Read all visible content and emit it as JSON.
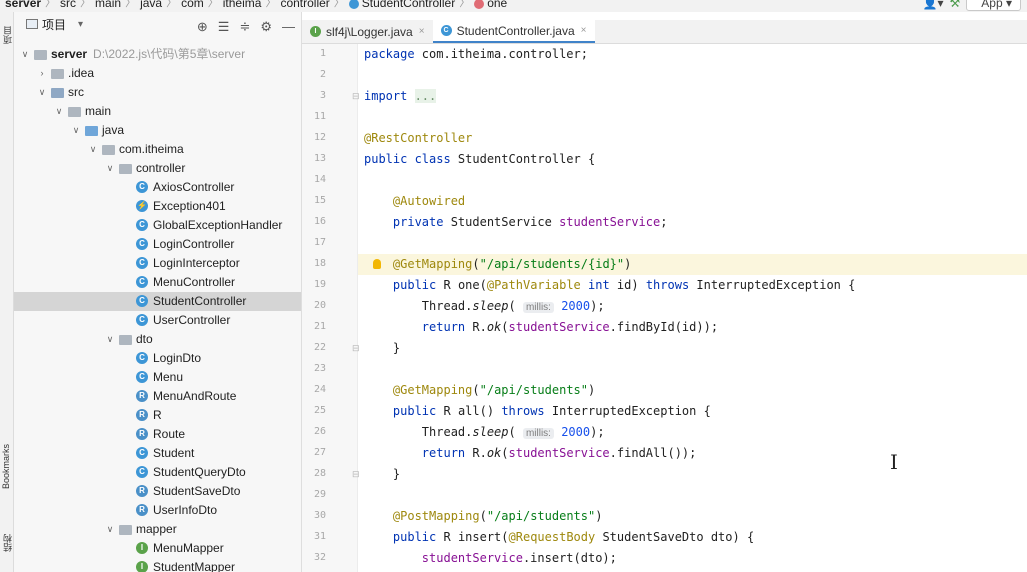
{
  "breadcrumb": {
    "items": [
      "server",
      "src",
      "main",
      "java",
      "com",
      "itheima",
      "controller",
      "StudentController",
      "one"
    ],
    "separator": "〉"
  },
  "topbar": {
    "app_config": "App ▾"
  },
  "toolstrip": {
    "project_label": "项目",
    "bookmarks_label": "Bookmarks",
    "structure_label": "结构"
  },
  "project_panel": {
    "title": "项目",
    "title_arrow": "▾",
    "tree": [
      {
        "label": "server",
        "hint": "D:\\2022.js\\代码\\第5章\\server",
        "icon": "module",
        "depth": 0,
        "expanded": true
      },
      {
        "label": ".idea",
        "icon": "folder",
        "depth": 1,
        "expanded": false
      },
      {
        "label": "src",
        "icon": "folder-src",
        "depth": 1,
        "expanded": true
      },
      {
        "label": "main",
        "icon": "folder",
        "depth": 2,
        "expanded": true
      },
      {
        "label": "java",
        "icon": "folder-java",
        "depth": 3,
        "expanded": true
      },
      {
        "label": "com.itheima",
        "icon": "package",
        "depth": 4,
        "expanded": true
      },
      {
        "label": "controller",
        "icon": "package",
        "depth": 5,
        "expanded": true
      },
      {
        "label": "AxiosController",
        "icon": "class",
        "depth": 6
      },
      {
        "label": "Exception401",
        "icon": "exception",
        "depth": 6
      },
      {
        "label": "GlobalExceptionHandler",
        "icon": "class",
        "depth": 6
      },
      {
        "label": "LoginController",
        "icon": "class",
        "depth": 6
      },
      {
        "label": "LoginInterceptor",
        "icon": "class",
        "depth": 6
      },
      {
        "label": "MenuController",
        "icon": "class",
        "depth": 6
      },
      {
        "label": "StudentController",
        "icon": "class",
        "depth": 6,
        "selected": true
      },
      {
        "label": "UserController",
        "icon": "class",
        "depth": 6
      },
      {
        "label": "dto",
        "icon": "package",
        "depth": 5,
        "expanded": true
      },
      {
        "label": "LoginDto",
        "icon": "class",
        "depth": 6
      },
      {
        "label": "Menu",
        "icon": "class",
        "depth": 6
      },
      {
        "label": "MenuAndRoute",
        "icon": "record",
        "depth": 6
      },
      {
        "label": "R",
        "icon": "record",
        "depth": 6
      },
      {
        "label": "Route",
        "icon": "record",
        "depth": 6
      },
      {
        "label": "Student",
        "icon": "class",
        "depth": 6
      },
      {
        "label": "StudentQueryDto",
        "icon": "class",
        "depth": 6
      },
      {
        "label": "StudentSaveDto",
        "icon": "record",
        "depth": 6
      },
      {
        "label": "UserInfoDto",
        "icon": "record",
        "depth": 6
      },
      {
        "label": "mapper",
        "icon": "package",
        "depth": 5,
        "expanded": true
      },
      {
        "label": "MenuMapper",
        "icon": "interface",
        "depth": 6
      },
      {
        "label": "StudentMapper",
        "icon": "interface",
        "depth": 6
      }
    ]
  },
  "tabs": [
    {
      "label": "slf4j\\Logger.java",
      "icon": "interface",
      "active": false
    },
    {
      "label": "StudentController.java",
      "icon": "class",
      "active": true
    }
  ],
  "editor": {
    "lines": [
      {
        "n": "1",
        "tokens": [
          {
            "t": "package ",
            "c": "kw"
          },
          {
            "t": "com.itheima.controller;",
            "c": ""
          }
        ]
      },
      {
        "n": "2",
        "tokens": []
      },
      {
        "n": "3",
        "tokens": [
          {
            "t": "import ",
            "c": "kw"
          },
          {
            "t": "...",
            "c": "fold"
          }
        ],
        "fold": true
      },
      {
        "n": "11",
        "tokens": []
      },
      {
        "n": "12",
        "tokens": [
          {
            "t": "@RestController",
            "c": "ann"
          }
        ]
      },
      {
        "n": "13",
        "tokens": [
          {
            "t": "public class ",
            "c": "kw"
          },
          {
            "t": "StudentController {",
            "c": ""
          }
        ]
      },
      {
        "n": "14",
        "tokens": []
      },
      {
        "n": "15",
        "tokens": [
          {
            "t": "    ",
            "c": ""
          },
          {
            "t": "@Autowired",
            "c": "ann"
          }
        ]
      },
      {
        "n": "16",
        "tokens": [
          {
            "t": "    ",
            "c": ""
          },
          {
            "t": "private ",
            "c": "kw"
          },
          {
            "t": "StudentService ",
            "c": ""
          },
          {
            "t": "studentService",
            "c": "fld"
          },
          {
            "t": ";",
            "c": ""
          }
        ]
      },
      {
        "n": "17",
        "tokens": []
      },
      {
        "n": "18",
        "tokens": [
          {
            "t": "    ",
            "c": ""
          },
          {
            "t": "@GetMapping",
            "c": "ann"
          },
          {
            "t": "(",
            "c": ""
          },
          {
            "t": "\"/api/students/{id}\"",
            "c": "str"
          },
          {
            "t": ")",
            "c": ""
          }
        ],
        "highlight": true,
        "bulb": true
      },
      {
        "n": "19",
        "tokens": [
          {
            "t": "    ",
            "c": ""
          },
          {
            "t": "public ",
            "c": "kw"
          },
          {
            "t": "R ",
            "c": ""
          },
          {
            "t": "one",
            "c": ""
          },
          {
            "t": "(",
            "c": ""
          },
          {
            "t": "@PathVariable ",
            "c": "ann"
          },
          {
            "t": "int ",
            "c": "kw"
          },
          {
            "t": "id) ",
            "c": ""
          },
          {
            "t": "throws ",
            "c": "kw"
          },
          {
            "t": "InterruptedException {",
            "c": ""
          }
        ]
      },
      {
        "n": "20",
        "tokens": [
          {
            "t": "        Thread.",
            "c": ""
          },
          {
            "t": "sleep",
            "c": "ital"
          },
          {
            "t": "( ",
            "c": ""
          },
          {
            "t": "millis:",
            "c": "hint"
          },
          {
            "t": " ",
            "c": ""
          },
          {
            "t": "2000",
            "c": "num"
          },
          {
            "t": ");",
            "c": ""
          }
        ]
      },
      {
        "n": "21",
        "tokens": [
          {
            "t": "        ",
            "c": ""
          },
          {
            "t": "return ",
            "c": "kw"
          },
          {
            "t": "R.",
            "c": ""
          },
          {
            "t": "ok",
            "c": "ital"
          },
          {
            "t": "(",
            "c": ""
          },
          {
            "t": "studentService",
            "c": "fld"
          },
          {
            "t": ".findById(id));",
            "c": ""
          }
        ]
      },
      {
        "n": "22",
        "tokens": [
          {
            "t": "    }",
            "c": ""
          }
        ],
        "fold": true
      },
      {
        "n": "23",
        "tokens": []
      },
      {
        "n": "24",
        "tokens": [
          {
            "t": "    ",
            "c": ""
          },
          {
            "t": "@GetMapping",
            "c": "ann"
          },
          {
            "t": "(",
            "c": ""
          },
          {
            "t": "\"/api/students\"",
            "c": "str"
          },
          {
            "t": ")",
            "c": ""
          }
        ]
      },
      {
        "n": "25",
        "tokens": [
          {
            "t": "    ",
            "c": ""
          },
          {
            "t": "public ",
            "c": "kw"
          },
          {
            "t": "R ",
            "c": ""
          },
          {
            "t": "all",
            "c": ""
          },
          {
            "t": "() ",
            "c": ""
          },
          {
            "t": "throws ",
            "c": "kw"
          },
          {
            "t": "InterruptedException {",
            "c": ""
          }
        ]
      },
      {
        "n": "26",
        "tokens": [
          {
            "t": "        Thread.",
            "c": ""
          },
          {
            "t": "sleep",
            "c": "ital"
          },
          {
            "t": "( ",
            "c": ""
          },
          {
            "t": "millis:",
            "c": "hint"
          },
          {
            "t": " ",
            "c": ""
          },
          {
            "t": "2000",
            "c": "num"
          },
          {
            "t": ");",
            "c": ""
          }
        ]
      },
      {
        "n": "27",
        "tokens": [
          {
            "t": "        ",
            "c": ""
          },
          {
            "t": "return ",
            "c": "kw"
          },
          {
            "t": "R.",
            "c": ""
          },
          {
            "t": "ok",
            "c": "ital"
          },
          {
            "t": "(",
            "c": ""
          },
          {
            "t": "studentService",
            "c": "fld"
          },
          {
            "t": ".findAll());",
            "c": ""
          }
        ]
      },
      {
        "n": "28",
        "tokens": [
          {
            "t": "    }",
            "c": ""
          }
        ],
        "fold": true
      },
      {
        "n": "29",
        "tokens": []
      },
      {
        "n": "30",
        "tokens": [
          {
            "t": "    ",
            "c": ""
          },
          {
            "t": "@PostMapping",
            "c": "ann"
          },
          {
            "t": "(",
            "c": ""
          },
          {
            "t": "\"/api/students\"",
            "c": "str"
          },
          {
            "t": ")",
            "c": ""
          }
        ]
      },
      {
        "n": "31",
        "tokens": [
          {
            "t": "    ",
            "c": ""
          },
          {
            "t": "public ",
            "c": "kw"
          },
          {
            "t": "R ",
            "c": ""
          },
          {
            "t": "insert",
            "c": ""
          },
          {
            "t": "(",
            "c": ""
          },
          {
            "t": "@RequestBody ",
            "c": "ann"
          },
          {
            "t": "StudentSaveDto dto) {",
            "c": ""
          }
        ]
      },
      {
        "n": "32",
        "tokens": [
          {
            "t": "        ",
            "c": ""
          },
          {
            "t": "studentService",
            "c": "fld"
          },
          {
            "t": ".insert(dto);",
            "c": ""
          }
        ]
      }
    ]
  },
  "colors": {
    "accent": "#4083c9",
    "keyword": "#0033b3",
    "annotation": "#9e880d",
    "string": "#067d17",
    "field": "#871094",
    "number": "#1750eb"
  }
}
